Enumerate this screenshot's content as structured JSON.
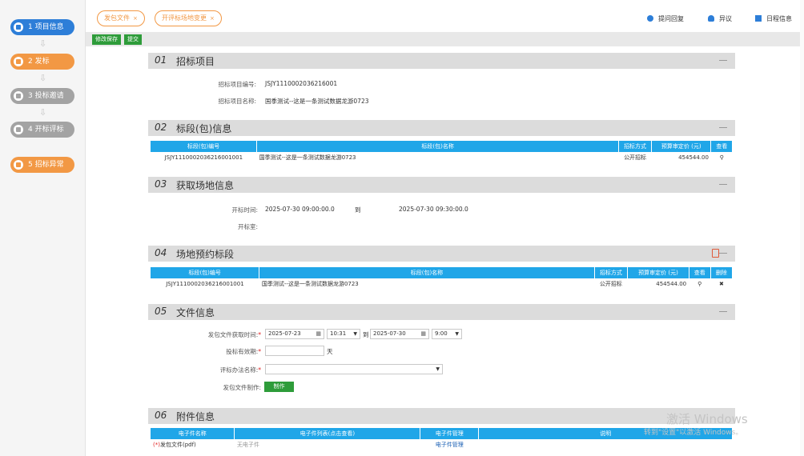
{
  "sidebar": {
    "steps": [
      {
        "label": "1 项目信息"
      },
      {
        "label": "2 发标"
      },
      {
        "label": "3 投标邀请"
      },
      {
        "label": "4 开标评标"
      },
      {
        "label": "5 招标异常"
      }
    ]
  },
  "tabs": [
    {
      "label": "发包文件"
    },
    {
      "label": "开评标场地变更"
    }
  ],
  "toplinks": {
    "qa": "提问回复",
    "objection": "异议",
    "schedule": "日程信息"
  },
  "toolbar": {
    "save": "修改保存",
    "submit": "提交"
  },
  "sections": {
    "s1": {
      "num": "01",
      "title": "招标项目"
    },
    "s2": {
      "num": "02",
      "title": "标段(包)信息"
    },
    "s3": {
      "num": "03",
      "title": "获取场地信息"
    },
    "s4": {
      "num": "04",
      "title": "场地预约标段"
    },
    "s5": {
      "num": "05",
      "title": "文件信息"
    },
    "s6": {
      "num": "06",
      "title": "附件信息"
    }
  },
  "project": {
    "code_label": "招标项目编号:",
    "code": "JSJY1110002036216001",
    "name_label": "招标项目名称:",
    "name": "国季测试--这是一条测试数据龙游0723"
  },
  "lot_table": {
    "headers": [
      "标段(包)编号",
      "标段(包)名称",
      "招标方式",
      "预算审定价 (元)",
      "查看"
    ],
    "row": {
      "code": "JSJY1110002036216001001",
      "name": "国季测试--这是一条测试数据龙游0723",
      "method": "公开招标",
      "price": "454544.00"
    }
  },
  "venue": {
    "open_time_label": "开标时间:",
    "start": "2025-07-30 09:00:00.0",
    "to": "到",
    "end": "2025-07-30 09:30:00.0",
    "room_label": "开标室:"
  },
  "reserve_table": {
    "headers": [
      "标段(包)编号",
      "标段(包)名称",
      "招标方式",
      "预算审定价 (元)",
      "查看",
      "删除"
    ],
    "row": {
      "code": "JSJY1110002036216001001",
      "name": "国季测试--这是一条测试数据龙游0723",
      "method": "公开招标",
      "price": "454544.00"
    }
  },
  "fileinfo": {
    "get_time_label": "发包文件获取时间:",
    "date1": "2025-07-23",
    "time1": "10:31",
    "to": "到",
    "date2": "2025-07-30",
    "time2": "9:00",
    "valid_label": "投标有效期:",
    "valid_unit": "天",
    "eval_label": "评标办法名称:",
    "make_label": "发包文件制作:",
    "make_btn": "制作",
    "star": "*"
  },
  "attach_table": {
    "headers": [
      "电子件名称",
      "电子件列表(点击查看)",
      "电子件管理",
      "说明"
    ],
    "row": {
      "req": "(*)",
      "name": "发包文件(pdf)",
      "list": "无电子件",
      "manage": "电子件管理"
    }
  },
  "watermark": {
    "line1": "激活 Windows",
    "line2": "转到\"设置\"以激活 Windows。"
  }
}
